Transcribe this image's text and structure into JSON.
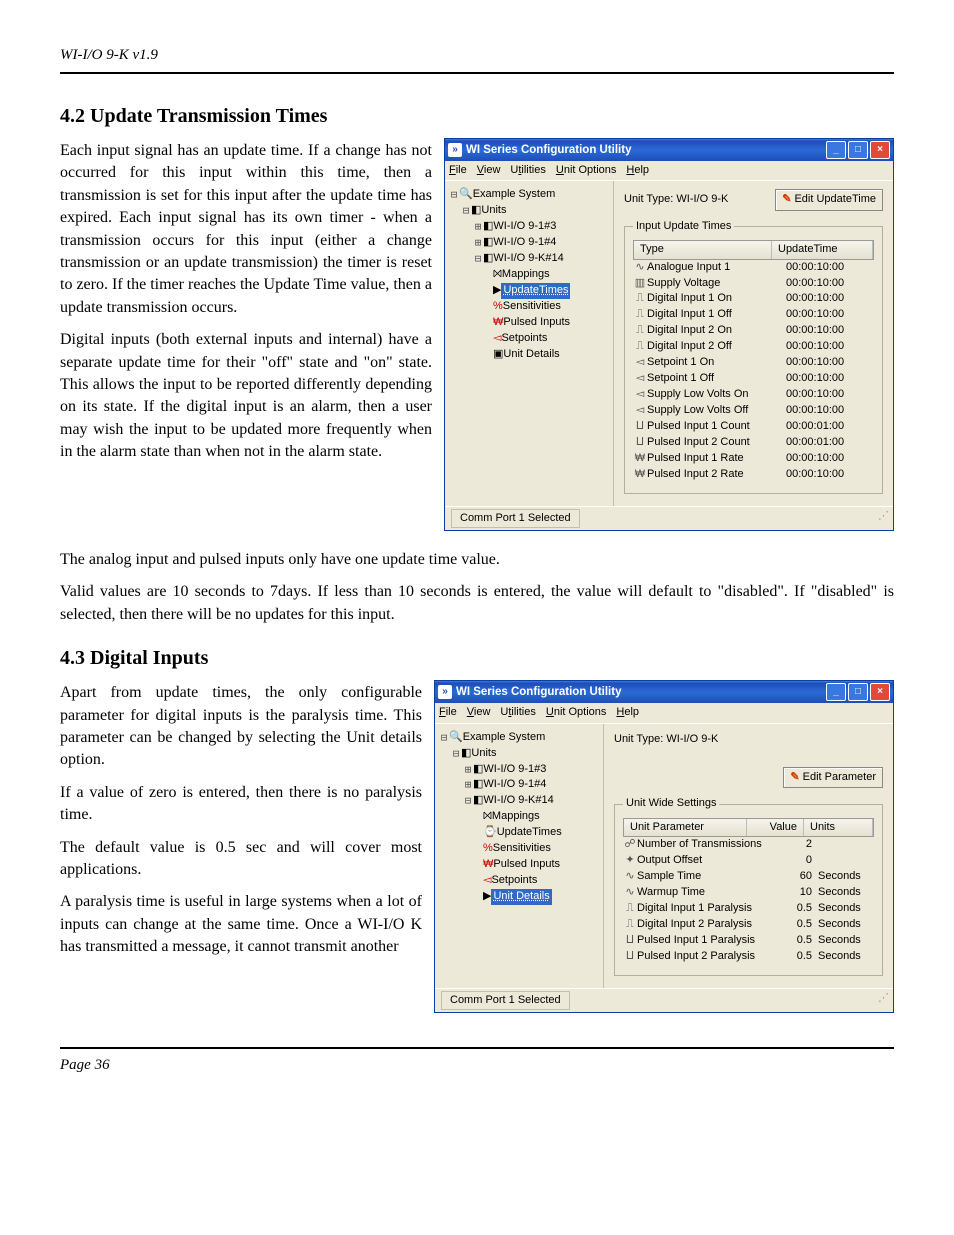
{
  "doc": {
    "header": "WI-I/O 9-K v1.9",
    "footer": "Page 36",
    "s42_title": "4.2   Update Transmission Times",
    "s42_p1": "Each input signal has an update time.  If a change has not occurred for this input within this time, then a transmission is set for this input after the update time has expired.  Each input signal has its own timer -  when a transmission occurs for this input (either a change transmission or an update transmission) the timer is reset to zero.  If the timer reaches the Update Time value, then a update transmission occurs.",
    "s42_p2": "Digital inputs (both external inputs and internal) have a separate update time for their \"off\" state and \"on\" state.  This allows the input to be reported differently depending on its state.  If the digital input is an alarm, then a user may wish the input to be updated more frequently when in the alarm state than when not in the alarm state.",
    "s42_p3": "The analog input and pulsed inputs only have one update time value.",
    "s42_p4": "Valid values are 10 seconds to 7days.  If less than 10 seconds is entered, the value will default to \"disabled\".  If \"disabled\" is selected, then there will be no updates for this input.",
    "s43_title": "4.3   Digital Inputs",
    "s43_p1": "Apart from update times,  the only configurable parameter for digital inputs is the paralysis time.  This parameter can be changed by selecting the Unit details option.",
    "s43_p2": "If a value of zero is entered, then there is no paralysis time.",
    "s43_p3": "The default value is 0.5 sec and will cover most applications.",
    "s43_p4": "A paralysis time is useful in large systems when a lot of inputs can change at the same time.  Once a WI-I/O K has transmitted a message, it cannot transmit another"
  },
  "win": {
    "title": "WI Series Configuration Utility",
    "menus": [
      "File",
      "View",
      "Utilities",
      "Unit Options",
      "Help"
    ],
    "status": "Comm Port 1 Selected"
  },
  "tree": {
    "root": "Example System",
    "units": "Units",
    "u3": "WI-I/O 9-1#3",
    "u4": "WI-I/O 9-1#4",
    "u14": "WI-I/O 9-K#14",
    "mappings": "Mappings",
    "updatetimes": "UpdateTimes",
    "sensitivities": "Sensitivities",
    "pulsed": "Pulsed Inputs",
    "setpoints": "Setpoints",
    "unitdetails": "Unit Details"
  },
  "shot1": {
    "unitTypeLabel": "Unit Type:  WI-I/O 9-K",
    "editBtn": "Edit UpdateTime",
    "groupTitle": "Input Update Times",
    "col1": "Type",
    "col2": "UpdateTime",
    "rows": [
      {
        "i": "∿",
        "n": "Analogue Input 1",
        "t": "00:00:10:00"
      },
      {
        "i": "▥",
        "n": "Supply Voltage",
        "t": "00:00:10:00"
      },
      {
        "i": "⎍",
        "n": "Digital Input 1 On",
        "t": "00:00:10:00"
      },
      {
        "i": "⎍",
        "n": "Digital Input 1 Off",
        "t": "00:00:10:00"
      },
      {
        "i": "⎍",
        "n": "Digital Input 2 On",
        "t": "00:00:10:00"
      },
      {
        "i": "⎍",
        "n": "Digital Input 2 Off",
        "t": "00:00:10:00"
      },
      {
        "i": "◅",
        "n": "Setpoint 1 On",
        "t": "00:00:10:00"
      },
      {
        "i": "◅",
        "n": "Setpoint 1 Off",
        "t": "00:00:10:00"
      },
      {
        "i": "◅",
        "n": "Supply Low Volts On",
        "t": "00:00:10:00"
      },
      {
        "i": "◅",
        "n": "Supply Low Volts Off",
        "t": "00:00:10:00"
      },
      {
        "i": "⨿",
        "n": "Pulsed Input 1 Count",
        "t": "00:00:01:00"
      },
      {
        "i": "⨿",
        "n": "Pulsed Input 2 Count",
        "t": "00:00:01:00"
      },
      {
        "i": "₩",
        "n": "Pulsed Input 1 Rate",
        "t": "00:00:10:00"
      },
      {
        "i": "₩",
        "n": "Pulsed Input 2 Rate",
        "t": "00:00:10:00"
      }
    ]
  },
  "shot2": {
    "unitTypeLabel": "Unit Type:     WI-I/O 9-K",
    "editBtn": "Edit Parameter",
    "groupTitle": "Unit Wide Settings",
    "col1": "Unit Parameter",
    "col2": "Value",
    "col3": "Units",
    "rows": [
      {
        "i": "☍",
        "n": "Number of Transmissions",
        "v": "2",
        "u": ""
      },
      {
        "i": "✦",
        "n": "Output Offset",
        "v": "0",
        "u": ""
      },
      {
        "i": "∿",
        "n": "Sample Time",
        "v": "60",
        "u": "Seconds"
      },
      {
        "i": "∿",
        "n": "Warmup Time",
        "v": "10",
        "u": "Seconds"
      },
      {
        "i": "⎍",
        "n": "Digital Input 1 Paralysis",
        "v": "0.5",
        "u": "Seconds"
      },
      {
        "i": "⎍",
        "n": "Digital Input 2 Paralysis",
        "v": "0.5",
        "u": "Seconds"
      },
      {
        "i": "⨿",
        "n": "Pulsed Input 1 Paralysis",
        "v": "0.5",
        "u": "Seconds"
      },
      {
        "i": "⨿",
        "n": "Pulsed Input 2 Paralysis",
        "v": "0.5",
        "u": "Seconds"
      }
    ]
  }
}
